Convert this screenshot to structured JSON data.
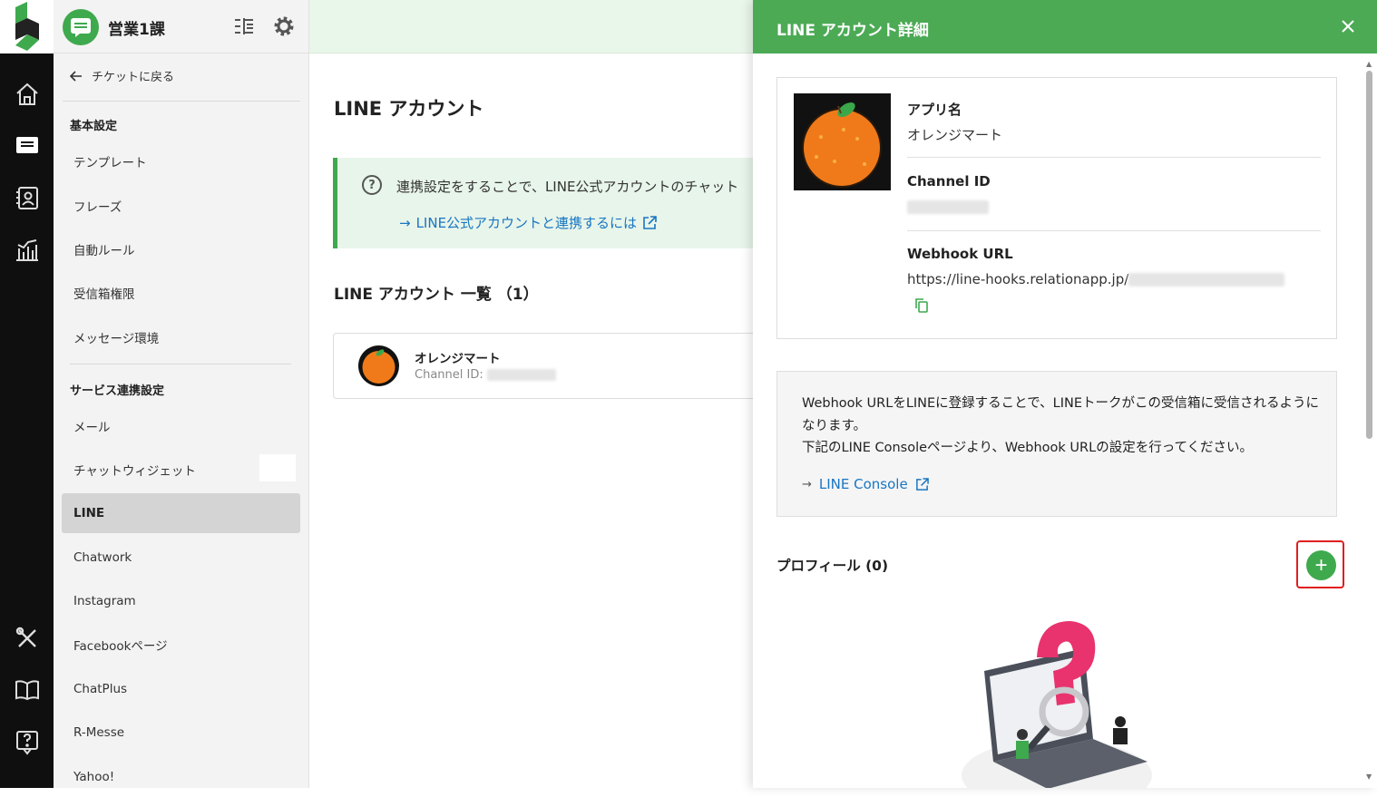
{
  "sidebar": {
    "inbox_name": "営業1課",
    "back_label": "チケットに戻る",
    "sections": [
      {
        "title": "基本設定",
        "items": [
          "テンプレート",
          "フレーズ",
          "自動ルール",
          "受信箱権限",
          "メッセージ環境"
        ]
      },
      {
        "title": "サービス連携設定",
        "items": [
          "メール",
          "チャットウィジェット",
          "LINE",
          "Chatwork",
          "Instagram",
          "Facebookページ",
          "ChatPlus",
          "R-Messe",
          "Yahoo!"
        ]
      }
    ],
    "active_item": "LINE"
  },
  "rail_icons": [
    "home-icon",
    "ticket-icon",
    "contacts-icon",
    "analytics-icon",
    "tools-icon",
    "book-icon",
    "help-icon"
  ],
  "main": {
    "title": "LINE アカウント",
    "info_text": "連携設定をすることで、LINE公式アカウントのチャット",
    "info_link": "LINE公式アカウントと連携するには",
    "list_title": "LINE アカウント 一覧 （1）",
    "account": {
      "name": "オレンジマート",
      "channel_label": "Channel ID:"
    }
  },
  "panel": {
    "title": "LINE アカウント詳細",
    "app_name_label": "アプリ名",
    "app_name_value": "オレンジマート",
    "channel_id_label": "Channel ID",
    "webhook_label": "Webhook URL",
    "webhook_value": "https://line-hooks.relationapp.jp/",
    "note_line1": "Webhook URLをLINEに登録することで、LINEトークがこの受信箱に受信されるようになります。",
    "note_line2": "下記のLINE Consoleページより、Webhook URLの設定を行ってください。",
    "console_link": "LINE Console",
    "profile_title": "プロフィール (0)",
    "add_label": "+"
  },
  "colors": {
    "brand_green": "#4caa55",
    "link_blue": "#1976c2",
    "highlight_red": "#e01e1e"
  }
}
